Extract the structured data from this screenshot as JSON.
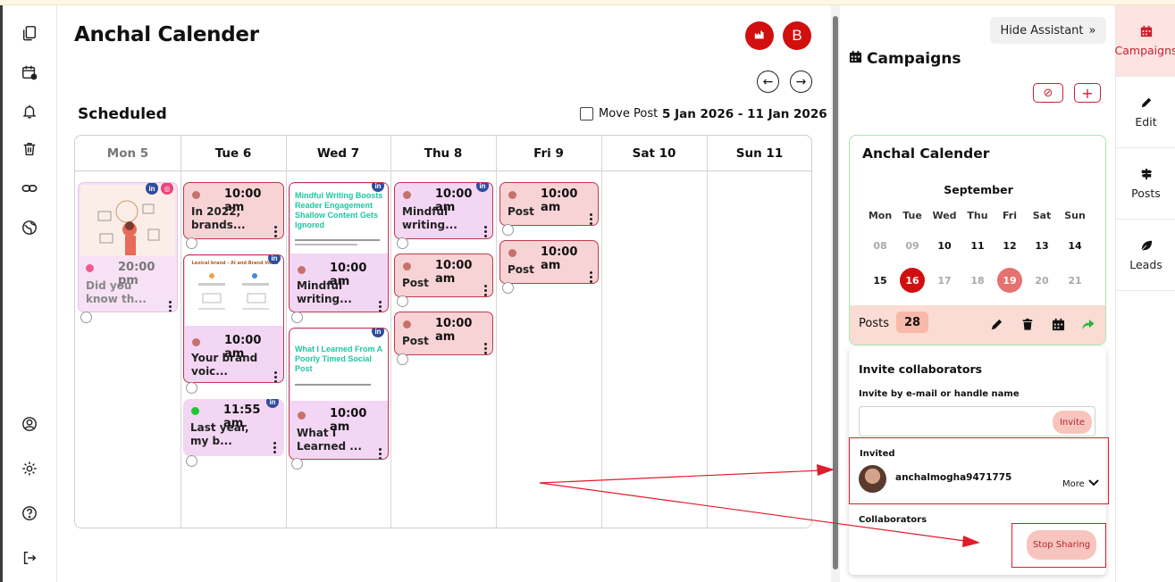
{
  "left_nav": {
    "icons": [
      "copy-icon",
      "calendar-icon",
      "notification-bell-icon",
      "trash-icon",
      "link-icon",
      "globe-icon",
      "user-circle-icon",
      "settings-gear-icon",
      "help-icon",
      "logout-icon"
    ]
  },
  "header": {
    "title": "Anchal Calender",
    "brand_avatar_letter": "B",
    "section_title": "Scheduled",
    "move_post_label": "Move Post",
    "date_range": "5 Jan 2026 - 11 Jan 2026"
  },
  "calendar": {
    "days": [
      "Mon 5",
      "Tue 6",
      "Wed 7",
      "Thu 8",
      "Fri 9",
      "Sat 10",
      "Sun 11"
    ],
    "posts": {
      "mon_1": {
        "time": "20:00 pm",
        "text": "Did you know th..."
      },
      "tue_1": {
        "time": "10:00 am",
        "text": "In 2022, brands..."
      },
      "tue_2": {
        "time": "10:00 am",
        "text": "Your brand voic...",
        "thumb_title": "Lexical brand - AI and Brand Voice"
      },
      "tue_3": {
        "time": "11:55 am",
        "text": "Last year, my b..."
      },
      "wed_1": {
        "thumb_title": "Mindful Writing Boosts Reader Engagement Shallow Content Gets Ignored",
        "time": "10:00 am",
        "text": "Mindful writing..."
      },
      "wed_2": {
        "thumb_title": "What I Learned From A Poorly Timed Social Post",
        "time": "10:00 am",
        "text": "What I Learned ..."
      },
      "thu_1": {
        "time": "10:00 am",
        "text": "Mindful writing..."
      },
      "thu_2": {
        "time": "10:00 am",
        "text": "Post"
      },
      "thu_3": {
        "time": "10:00 am",
        "text": "Post"
      },
      "fri_1": {
        "time": "10:00 am",
        "text": "Post"
      },
      "fri_2": {
        "time": "10:00 am",
        "text": "Post"
      }
    },
    "colors": {
      "pink": "#f8d3d5",
      "violet": "#f3d6f3",
      "accent_red": "#d10f0f",
      "linkedin": "#2e4d9c"
    }
  },
  "assistant": {
    "hide_label": "Hide Assistant",
    "campaigns_title": "Campaigns",
    "campaign_card": {
      "title": "Anchal Calender",
      "month": "September",
      "weekdays": [
        "Mon",
        "Tue",
        "Wed",
        "Thu",
        "Fri",
        "Sat",
        "Sun"
      ],
      "week1": [
        "08",
        "09",
        "10",
        "11",
        "12",
        "13",
        "14"
      ],
      "week2": [
        "15",
        "16",
        "17",
        "18",
        "19",
        "20",
        "21"
      ],
      "posts_label": "Posts",
      "posts_count": "28"
    },
    "invite": {
      "title": "Invite collaborators",
      "field_label": "Invite by e-mail or handle name",
      "invite_button": "Invite",
      "invited_label": "Invited",
      "invited_user": "anchalmogha9471775",
      "more_label": "More",
      "collaborators_label": "Collaborators",
      "stop_sharing_button": "Stop Sharing"
    }
  },
  "right_rail": {
    "items": [
      {
        "label": "Campaigns",
        "icon": "calendar-icon"
      },
      {
        "label": "Edit",
        "icon": "pencil-icon"
      },
      {
        "label": "Posts",
        "icon": "signpost-icon"
      },
      {
        "label": "Leads",
        "icon": "leaf-icon"
      }
    ]
  }
}
